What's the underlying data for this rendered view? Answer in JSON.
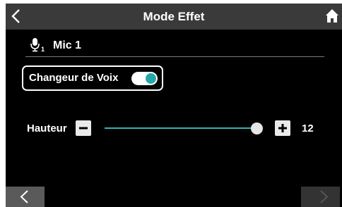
{
  "header": {
    "title": "Mode Effet",
    "back_icon": "chevron-left-icon",
    "home_icon": "home-icon"
  },
  "mic": {
    "icon": "microphone-icon",
    "icon_subscript": "1",
    "label": "Mic 1"
  },
  "voice_changer": {
    "label": "Changeur de Voix",
    "enabled": true
  },
  "pitch": {
    "label": "Hauteur",
    "value": "12",
    "level_fraction": 1.0
  },
  "footer": {
    "prev_icon": "chevron-left-icon",
    "next_icon": "chevron-right-icon"
  },
  "colors": {
    "accent": "#26a7a7",
    "background": "#000000",
    "header": "#3a3a3a"
  }
}
